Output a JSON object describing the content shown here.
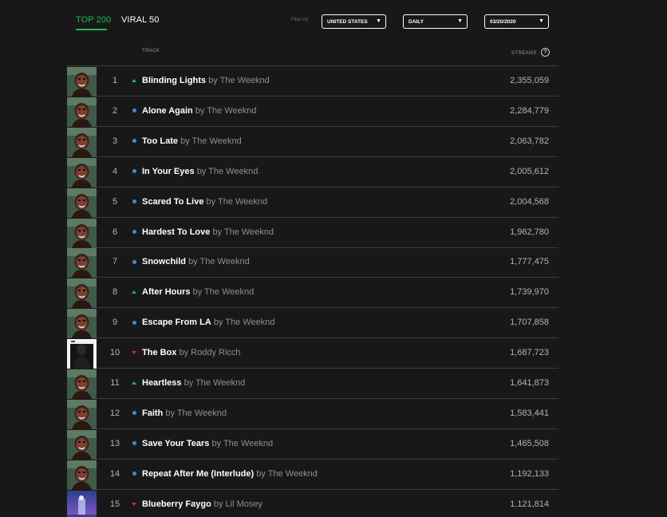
{
  "tabs": [
    {
      "label": "TOP 200",
      "active": true
    },
    {
      "label": "VIRAL 50",
      "active": false
    }
  ],
  "filters": {
    "label": "Filter by",
    "country": "UNITED STATES",
    "frequency": "DAILY",
    "date": "03/20/2020"
  },
  "header": {
    "track": "TRACK",
    "streams": "STREAMS"
  },
  "colors": {
    "accent": "#1db954",
    "up": "#1db954",
    "same": "#4687d6",
    "down": "#e22134",
    "background": "#181818"
  },
  "rows": [
    {
      "rank": "1",
      "movement": "up",
      "track": "Blinding Lights",
      "artist": "by The Weeknd",
      "streams": "2,355,059",
      "art": "after-hours"
    },
    {
      "rank": "2",
      "movement": "same",
      "track": "Alone Again",
      "artist": "by The Weeknd",
      "streams": "2,284,779",
      "art": "after-hours"
    },
    {
      "rank": "3",
      "movement": "same",
      "track": "Too Late",
      "artist": "by The Weeknd",
      "streams": "2,063,782",
      "art": "after-hours"
    },
    {
      "rank": "4",
      "movement": "same",
      "track": "In Your Eyes",
      "artist": "by The Weeknd",
      "streams": "2,005,612",
      "art": "after-hours"
    },
    {
      "rank": "5",
      "movement": "same",
      "track": "Scared To Live",
      "artist": "by The Weeknd",
      "streams": "2,004,568",
      "art": "after-hours"
    },
    {
      "rank": "6",
      "movement": "same",
      "track": "Hardest To Love",
      "artist": "by The Weeknd",
      "streams": "1,962,780",
      "art": "after-hours"
    },
    {
      "rank": "7",
      "movement": "same",
      "track": "Snowchild",
      "artist": "by The Weeknd",
      "streams": "1,777,475",
      "art": "after-hours"
    },
    {
      "rank": "8",
      "movement": "up",
      "track": "After Hours",
      "artist": "by The Weeknd",
      "streams": "1,739,970",
      "art": "after-hours"
    },
    {
      "rank": "9",
      "movement": "same",
      "track": "Escape From LA",
      "artist": "by The Weeknd",
      "streams": "1,707,858",
      "art": "after-hours"
    },
    {
      "rank": "10",
      "movement": "down",
      "track": "The Box",
      "artist": "by Roddy Ricch",
      "streams": "1,687,723",
      "art": "roddy"
    },
    {
      "rank": "11",
      "movement": "up",
      "track": "Heartless",
      "artist": "by The Weeknd",
      "streams": "1,641,873",
      "art": "after-hours"
    },
    {
      "rank": "12",
      "movement": "same",
      "track": "Faith",
      "artist": "by The Weeknd",
      "streams": "1,583,441",
      "art": "after-hours"
    },
    {
      "rank": "13",
      "movement": "same",
      "track": "Save Your Tears",
      "artist": "by The Weeknd",
      "streams": "1,465,508",
      "art": "after-hours"
    },
    {
      "rank": "14",
      "movement": "same",
      "track": "Repeat After Me (Interlude)",
      "artist": "by The Weeknd",
      "streams": "1,192,133",
      "art": "after-hours"
    },
    {
      "rank": "15",
      "movement": "down",
      "track": "Blueberry Faygo",
      "artist": "by Lil Mosey",
      "streams": "1,121,814",
      "art": "mosey"
    }
  ]
}
